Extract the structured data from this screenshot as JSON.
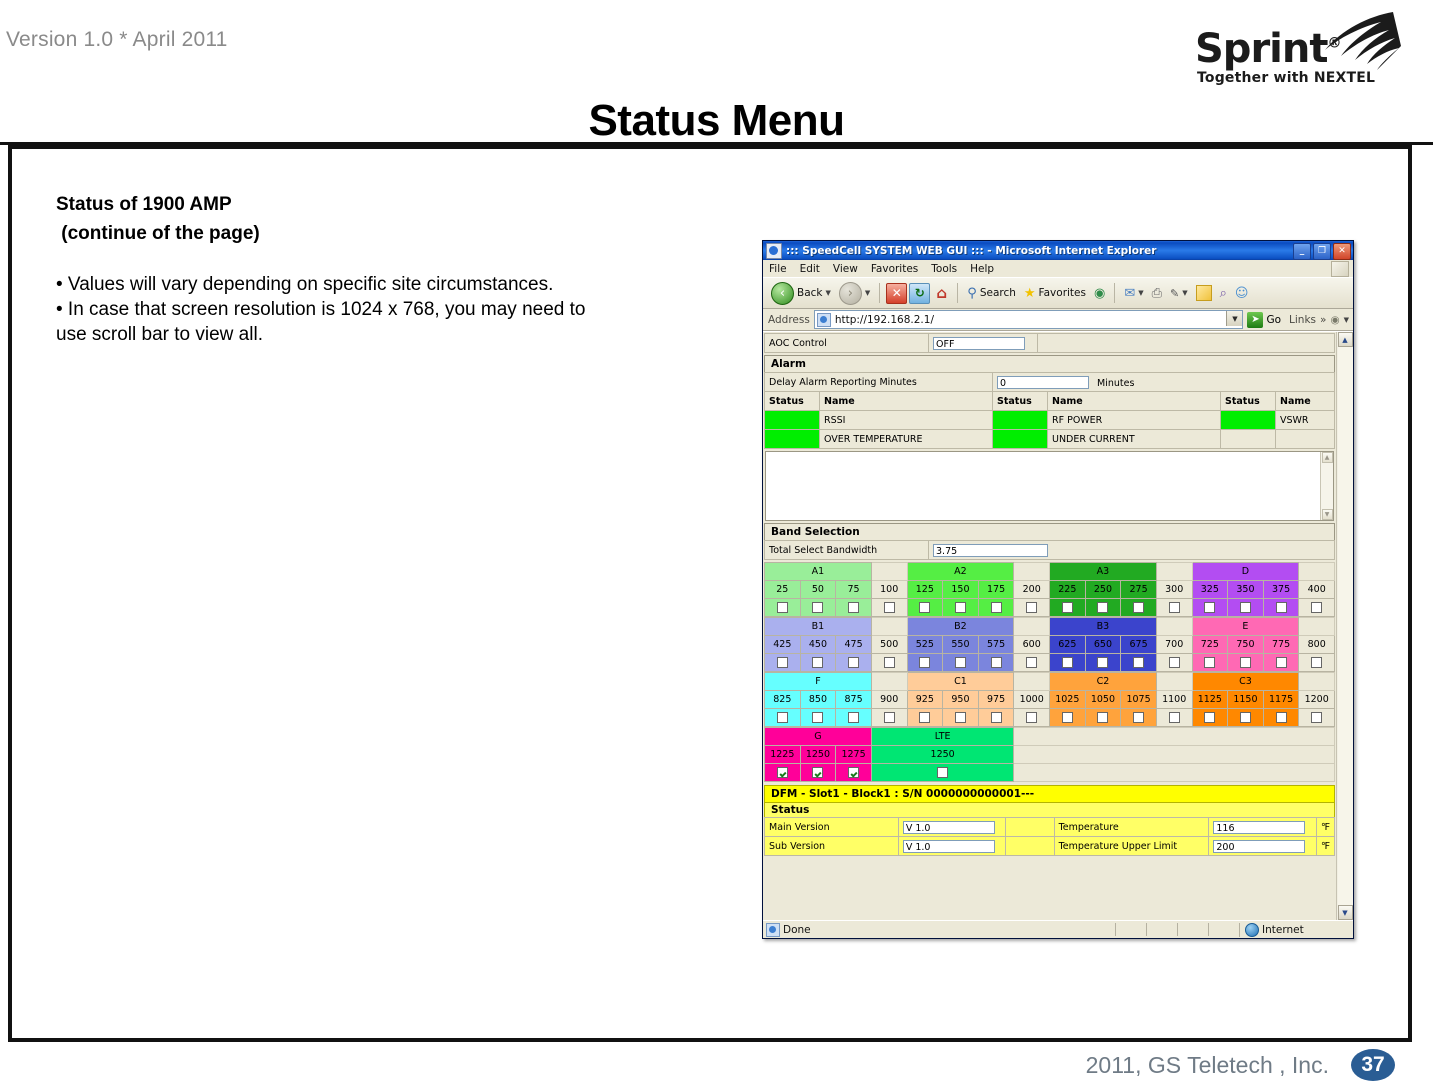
{
  "slide": {
    "version": "Version 1.0 * April 2011",
    "title": "Status Menu",
    "brand": "Sprint",
    "brand_reg": "®",
    "brand_tagline": "Together with NEXTEL",
    "heading_line1": "Status of 1900 AMP",
    "heading_line2": " (continue of the page)",
    "bullets": "• Values will vary depending on specific site circumstances.\n• In case that screen resolution is 1024 x 768, you may need to\nuse scroll bar to view all.",
    "footer": "2011, GS Teletech , Inc.",
    "page_number": "37"
  },
  "browser": {
    "title": "::: SpeedCell SYSTEM WEB GUI ::: - Microsoft Internet Explorer",
    "window_buttons": {
      "minimize": "_",
      "maximize": "❐",
      "close": "✕"
    },
    "menu": [
      "File",
      "Edit",
      "View",
      "Favorites",
      "Tools",
      "Help"
    ],
    "toolbar": {
      "back": "Back",
      "forward": "",
      "stop": "✕",
      "refresh": "↻",
      "home": "⌂",
      "search": "Search",
      "favorites": "Favorites",
      "media": "◉",
      "mail": "✉",
      "print": "⎙",
      "edit": "✎",
      "notes": "▭",
      "research": "⌕",
      "messenger": "☺"
    },
    "address_label": "Address",
    "address_value": "http://192.168.2.1/",
    "go_label": "Go",
    "links_label": "Links",
    "links_more": "»",
    "status_text": "Done",
    "status_zone": "Internet"
  },
  "page": {
    "aoc": {
      "label": "AOC Control",
      "value": "OFF"
    },
    "alarm": {
      "section_title": "Alarm",
      "delay_label": "Delay Alarm Reporting Minutes",
      "delay_value": "0",
      "delay_unit": "Minutes",
      "col_status": "Status",
      "col_name": "Name",
      "items": [
        {
          "name": "RSSI",
          "state": "green"
        },
        {
          "name": "RF POWER",
          "state": "green"
        },
        {
          "name": "VSWR",
          "state": "green"
        },
        {
          "name": "OVER TEMPERATURE",
          "state": "green"
        },
        {
          "name": "UNDER CURRENT",
          "state": "green"
        },
        {
          "name": "",
          "state": "none"
        }
      ],
      "log_text": ""
    },
    "band": {
      "section_title": "Band Selection",
      "total_label": "Total Select Bandwidth",
      "total_value": "3.75",
      "rows": [
        {
          "groups": [
            {
              "name": "A1",
              "color": "#99ee99",
              "channels": [
                "25",
                "50",
                "75"
              ],
              "checked": [
                false,
                false,
                false
              ],
              "gap": "100"
            },
            {
              "name": "A2",
              "color": "#55ee44",
              "channels": [
                "125",
                "150",
                "175"
              ],
              "checked": [
                false,
                false,
                false
              ],
              "gap": "200"
            },
            {
              "name": "A3",
              "color": "#22aa22",
              "channels": [
                "225",
                "250",
                "275"
              ],
              "checked": [
                false,
                false,
                false
              ],
              "gap": "300"
            },
            {
              "name": "D",
              "color": "#b34df2",
              "channels": [
                "325",
                "350",
                "375"
              ],
              "checked": [
                false,
                false,
                false
              ],
              "gap": "400"
            }
          ]
        },
        {
          "groups": [
            {
              "name": "B1",
              "color": "#aab0ee",
              "channels": [
                "425",
                "450",
                "475"
              ],
              "checked": [
                false,
                false,
                false
              ],
              "gap": "500"
            },
            {
              "name": "B2",
              "color": "#7b85dd",
              "channels": [
                "525",
                "550",
                "575"
              ],
              "checked": [
                false,
                false,
                false
              ],
              "gap": "600"
            },
            {
              "name": "B3",
              "color": "#3b44cc",
              "channels": [
                "625",
                "650",
                "675"
              ],
              "checked": [
                false,
                false,
                false
              ],
              "gap": "700"
            },
            {
              "name": "E",
              "color": "#ff69b4",
              "channels": [
                "725",
                "750",
                "775"
              ],
              "checked": [
                false,
                false,
                false
              ],
              "gap": "800"
            }
          ]
        },
        {
          "groups": [
            {
              "name": "F",
              "color": "#66ffff",
              "channels": [
                "825",
                "850",
                "875"
              ],
              "checked": [
                false,
                false,
                false
              ],
              "gap": "900"
            },
            {
              "name": "C1",
              "color": "#ffcc99",
              "channels": [
                "925",
                "950",
                "975"
              ],
              "checked": [
                false,
                false,
                false
              ],
              "gap": "1000"
            },
            {
              "name": "C2",
              "color": "#ffa33c",
              "channels": [
                "1025",
                "1050",
                "1075"
              ],
              "checked": [
                false,
                false,
                false
              ],
              "gap": "1100"
            },
            {
              "name": "C3",
              "color": "#ff8800",
              "channels": [
                "1125",
                "1150",
                "1175"
              ],
              "checked": [
                false,
                false,
                false
              ],
              "gap": "1200"
            }
          ]
        }
      ],
      "last_row": {
        "g": {
          "name": "G",
          "color": "#ff0099",
          "channels": [
            "1225",
            "1250",
            "1275"
          ],
          "checked": [
            true,
            true,
            true
          ]
        },
        "lte": {
          "name": "LTE",
          "color": "#00e673",
          "channel": "1250",
          "checked": false
        }
      }
    },
    "dfm": {
      "title": "DFM - Slot1 - Block1 : S/N 0000000000001---",
      "status_title": "Status",
      "main_version_label": "Main Version",
      "main_version_value": "V 1.0",
      "sub_version_label": "Sub Version",
      "sub_version_value": "V 1.0",
      "temperature_label": "Temperature",
      "temperature_value": "116",
      "temperature_unit": "℉",
      "temp_limit_label": "Temperature Upper Limit",
      "temp_limit_value": "200",
      "temp_limit_unit": "℉"
    }
  }
}
